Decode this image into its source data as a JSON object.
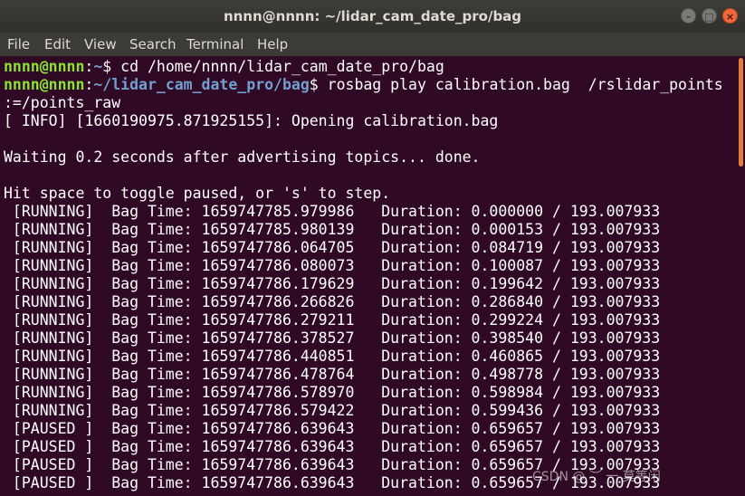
{
  "window": {
    "title": "nnnn@nnnn: ~/lidar_cam_date_pro/bag",
    "buttons": {
      "minimize": "–",
      "maximize": "□",
      "close": "×"
    }
  },
  "menubar": {
    "items": [
      "File",
      "Edit",
      "View",
      "Search",
      "Terminal",
      "Help"
    ]
  },
  "colors": {
    "background": "#300a24",
    "prompt_user": "#8ae234",
    "prompt_path": "#729fcf",
    "text": "#ffffff",
    "close_button": "#f0683b",
    "scroll_thumb": "#e27c3a"
  },
  "terminal": {
    "commands": [
      {
        "user_host": "nnnn@nnnn",
        "path": "~",
        "symbol": "$",
        "command": " cd /home/nnnn/lidar_cam_date_pro/bag"
      },
      {
        "user_host": "nnnn@nnnn",
        "path": "~/lidar_cam_date_pro/bag",
        "symbol": "$",
        "command": " rosbag play calibration.bag  /rslidar_points",
        "wrap": ":=/points_raw"
      }
    ],
    "output": [
      "[ INFO] [1660190975.871925155]: Opening calibration.bag",
      "",
      "Waiting 0.2 seconds after advertising topics... done.",
      "",
      "Hit space to toggle paused, or 's' to step.",
      " [RUNNING]  Bag Time: 1659747785.979986   Duration: 0.000000 / 193.007933",
      " [RUNNING]  Bag Time: 1659747785.980139   Duration: 0.000153 / 193.007933",
      " [RUNNING]  Bag Time: 1659747786.064705   Duration: 0.084719 / 193.007933",
      " [RUNNING]  Bag Time: 1659747786.080073   Duration: 0.100087 / 193.007933",
      " [RUNNING]  Bag Time: 1659747786.179629   Duration: 0.199642 / 193.007933",
      " [RUNNING]  Bag Time: 1659747786.266826   Duration: 0.286840 / 193.007933",
      " [RUNNING]  Bag Time: 1659747786.279211   Duration: 0.299224 / 193.007933",
      " [RUNNING]  Bag Time: 1659747786.378527   Duration: 0.398540 / 193.007933",
      " [RUNNING]  Bag Time: 1659747786.440851   Duration: 0.460865 / 193.007933",
      " [RUNNING]  Bag Time: 1659747786.478764   Duration: 0.498778 / 193.007933",
      " [RUNNING]  Bag Time: 1659747786.578970   Duration: 0.598984 / 193.007933",
      " [RUNNING]  Bag Time: 1659747786.579422   Duration: 0.599436 / 193.007933",
      " [PAUSED ]  Bag Time: 1659747786.639643   Duration: 0.659657 / 193.007933",
      " [PAUSED ]  Bag Time: 1659747786.639643   Duration: 0.659657 / 193.007933",
      " [PAUSED ]  Bag Time: 1659747786.639643   Duration: 0.659657 / 193.007933",
      " [PAUSED ]  Bag Time: 1659747786.639643   Duration: 0.659657 / 193.007933"
    ]
  },
  "watermark": "CSDN @ ︶ 一 莫等闲"
}
